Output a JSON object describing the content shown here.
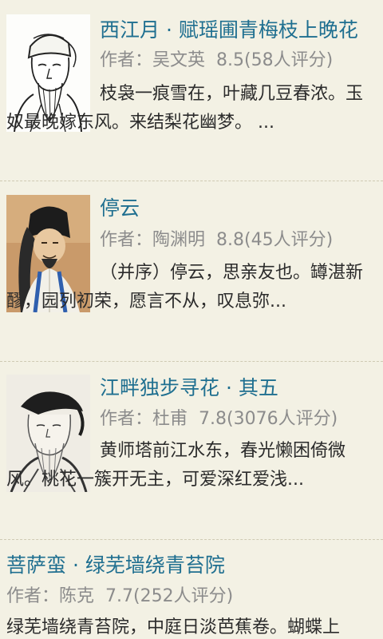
{
  "poems": [
    {
      "title": "西江月 · 赋瑶圃青梅枝上晚花",
      "author_prefix": "作者：",
      "author": "吴文英",
      "rating": "8.5(58人评分)",
      "excerpt": "枝袅一痕雪在，叶藏几豆春浓。玉奴最晚嫁东风。来结梨花幽梦。 ...",
      "portrait_icon": "portrait-scholar-hat-icon"
    },
    {
      "title": "停云",
      "author_prefix": "作者：",
      "author": "陶渊明",
      "rating": "8.8(45人评分)",
      "excerpt": "（并序）停云，思亲友也。罇湛新醪，园列初荣，愿言不从，叹息弥...",
      "portrait_icon": "portrait-painted-scholar-icon"
    },
    {
      "title": "江畔独步寻花 · 其五",
      "author_prefix": "作者：",
      "author": "杜甫",
      "rating": "7.8(3076人评分)",
      "excerpt": "黄师塔前江水东，春光懒困倚微风。桃花一簇开无主，可爱深红爱浅...",
      "portrait_icon": "portrait-ink-elder-icon"
    },
    {
      "title": "菩萨蛮 · 绿芜墙绕青苔院",
      "author_prefix": "作者：",
      "author": "陈克",
      "rating": "7.7(252人评分)",
      "excerpt": "绿芜墙绕青苔院，中庭日淡芭蕉卷。蝴蝶上"
    }
  ],
  "colors": {
    "background": "#f3f1e4",
    "title": "#1f6f90",
    "meta": "#8c8c8c",
    "text": "#2b2b2b"
  }
}
